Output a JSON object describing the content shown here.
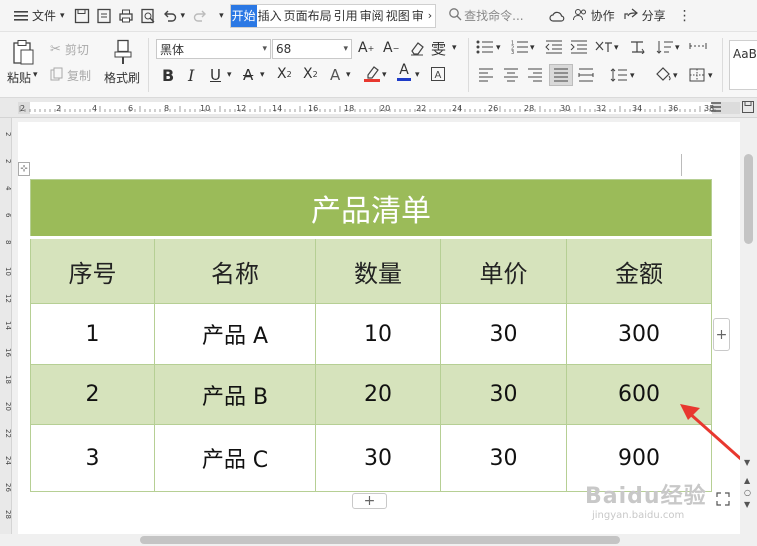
{
  "menubar": {
    "file_label": "文件",
    "tabs": [
      "开始",
      "插入",
      "页面布局",
      "引用",
      "审阅",
      "视图",
      "审"
    ],
    "search_placeholder": "查找命令...",
    "collab_label": "协作",
    "share_label": "分享"
  },
  "ribbon": {
    "paste_label": "粘贴",
    "cut_label": "剪切",
    "copy_label": "复制",
    "format_painter_label": "格式刷",
    "font_name": "黑体",
    "font_size": "68",
    "style_preview": "AaBl"
  },
  "ruler": {
    "top_ticks": [
      "2",
      "2",
      "4",
      "6",
      "8",
      "10",
      "12",
      "14",
      "16",
      "18",
      "20",
      "22",
      "24",
      "26",
      "28",
      "30",
      "32",
      "34",
      "36",
      "38"
    ],
    "left_ticks": [
      "2",
      "2",
      "4",
      "6",
      "8",
      "10",
      "12",
      "14",
      "16",
      "18",
      "20",
      "22",
      "24",
      "26",
      "28"
    ]
  },
  "table": {
    "title": "产品清单",
    "headers": [
      "序号",
      "名称",
      "数量",
      "单价",
      "金额"
    ],
    "rows": [
      [
        "1",
        "产品 A",
        "10",
        "30",
        "300"
      ],
      [
        "2",
        "产品 B",
        "20",
        "30",
        "600"
      ],
      [
        "3",
        "产品 C",
        "30",
        "30",
        "900"
      ]
    ]
  },
  "add_row_label": "+",
  "add_col_label": "+",
  "watermark": {
    "logo": "Baidu经验",
    "url": "jingyan.baidu.com"
  },
  "colors": {
    "title_bg": "#9bbb59",
    "band_bg": "#d6e3bc",
    "arrow": "#e8382f",
    "tab_active": "#2b78e4"
  }
}
